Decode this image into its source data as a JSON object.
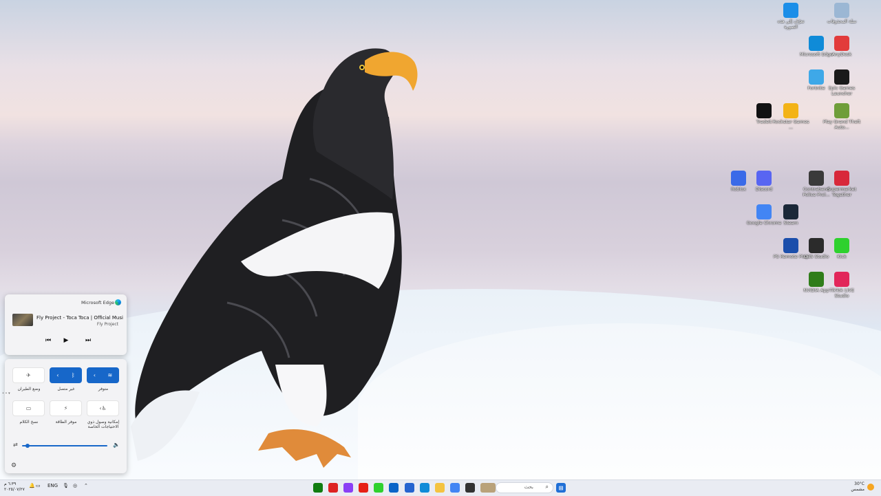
{
  "desktop": {
    "icons": [
      {
        "label": "تعرّف إلى هذه الصورة",
        "icon": "info-picture-icon",
        "color": "#1b8ee8"
      },
      {
        "label": "سلة المحذوفات",
        "icon": "recycle-bin-icon",
        "color": "#9bb7d4"
      },
      {
        "label": "Microsoft Edge",
        "icon": "edge-icon",
        "color": "#0f8bd8"
      },
      {
        "label": "AnyDesk",
        "icon": "anydesk-icon",
        "color": "#e23b3b"
      },
      {
        "label": "Fortnite",
        "icon": "fortnite-icon",
        "color": "#3ea8e8"
      },
      {
        "label": "Epic Games Launcher",
        "icon": "epic-games-icon",
        "color": "#1a1a1a"
      },
      {
        "label": "Tradeit",
        "icon": "tradeit-icon",
        "color": "#111111"
      },
      {
        "label": "Rockstar Games ...",
        "icon": "rockstar-icon",
        "color": "#f3b316"
      },
      {
        "label": "Play Grand Theft Auto...",
        "icon": "gta-icon",
        "color": "#6f9e3a"
      },
      {
        "label": "Roblox",
        "icon": "roblox-icon",
        "color": "#3a6ae8"
      },
      {
        "label": "Discord",
        "icon": "discord-icon",
        "color": "#5865f2"
      },
      {
        "label": "Contraband Police Prol...",
        "icon": "contraband-icon",
        "color": "#3a3a3a"
      },
      {
        "label": "Supermarket Together",
        "icon": "supermarket-icon",
        "color": "#d8283a"
      },
      {
        "label": "Google Chrome",
        "icon": "chrome-icon",
        "color": "#4285f4"
      },
      {
        "label": "Steam",
        "icon": "steam-icon",
        "color": "#1b2838"
      },
      {
        "label": "PS Remote Play",
        "icon": "ps-remote-icon",
        "color": "#1b4eab"
      },
      {
        "label": "OBS Studio",
        "icon": "obs-icon",
        "color": "#2b2b2b"
      },
      {
        "label": "Kick",
        "icon": "kick-icon",
        "color": "#2ed12e"
      },
      {
        "label": "NVIDIA App",
        "icon": "nvidia-icon",
        "color": "#2f7d1a"
      },
      {
        "label": "TikTok LIVE Studio",
        "icon": "tiktok-icon",
        "color": "#e2265a"
      }
    ]
  },
  "media": {
    "app_name": "Microsoft Edge",
    "title": "Fly Project - Toca Toca | Official Musi...",
    "artist": "Fly Project"
  },
  "quick_settings": {
    "tiles": [
      {
        "label": "متوفر",
        "glyph": "≋",
        "chevron": "‹",
        "on": true
      },
      {
        "label": "غير متصل",
        "glyph": "ᛒ",
        "chevron": "‹",
        "on": true
      },
      {
        "label": "وضع الطيران",
        "glyph": "✈",
        "on": false
      },
      {
        "label": "إمكانية وصول ذوي الاحتياجات الخاصة",
        "glyph": "♿",
        "chevron": "‹",
        "on": false
      },
      {
        "label": "موفر الطاقة",
        "glyph": "⚡",
        "on": false
      },
      {
        "label": "نسخ الكلام",
        "glyph": "▭",
        "on": false
      }
    ],
    "volume_level": 0.02,
    "pager": "• • ▾"
  },
  "taskbar": {
    "search_placeholder": "بحث",
    "language": "ENG",
    "time": "٦:٣٩ م",
    "date": "٢٠٢٥/٠٧/٢٧",
    "temperature": "30°C",
    "weather_desc": "مشمس",
    "apps": [
      {
        "icon": "xbox-icon",
        "color": "#107c10"
      },
      {
        "icon": "rockstar-launcher-icon",
        "color": "#d22"
      },
      {
        "icon": "messenger-icon",
        "color": "#8a3ff5"
      },
      {
        "icon": "youtube-icon",
        "color": "#e62117"
      },
      {
        "icon": "kick-icon",
        "color": "#2ed12e"
      },
      {
        "icon": "mail-icon",
        "color": "#0a64c8"
      },
      {
        "icon": "store-icon",
        "color": "#2564cf"
      },
      {
        "icon": "edge-icon",
        "color": "#0f8bd8"
      },
      {
        "icon": "file-explorer-icon",
        "color": "#f4c340"
      },
      {
        "icon": "chrome-icon",
        "color": "#4285f4"
      },
      {
        "icon": "terminal-icon",
        "color": "#333"
      },
      {
        "icon": "widgets-icon",
        "color": "#b9a27a"
      }
    ]
  }
}
